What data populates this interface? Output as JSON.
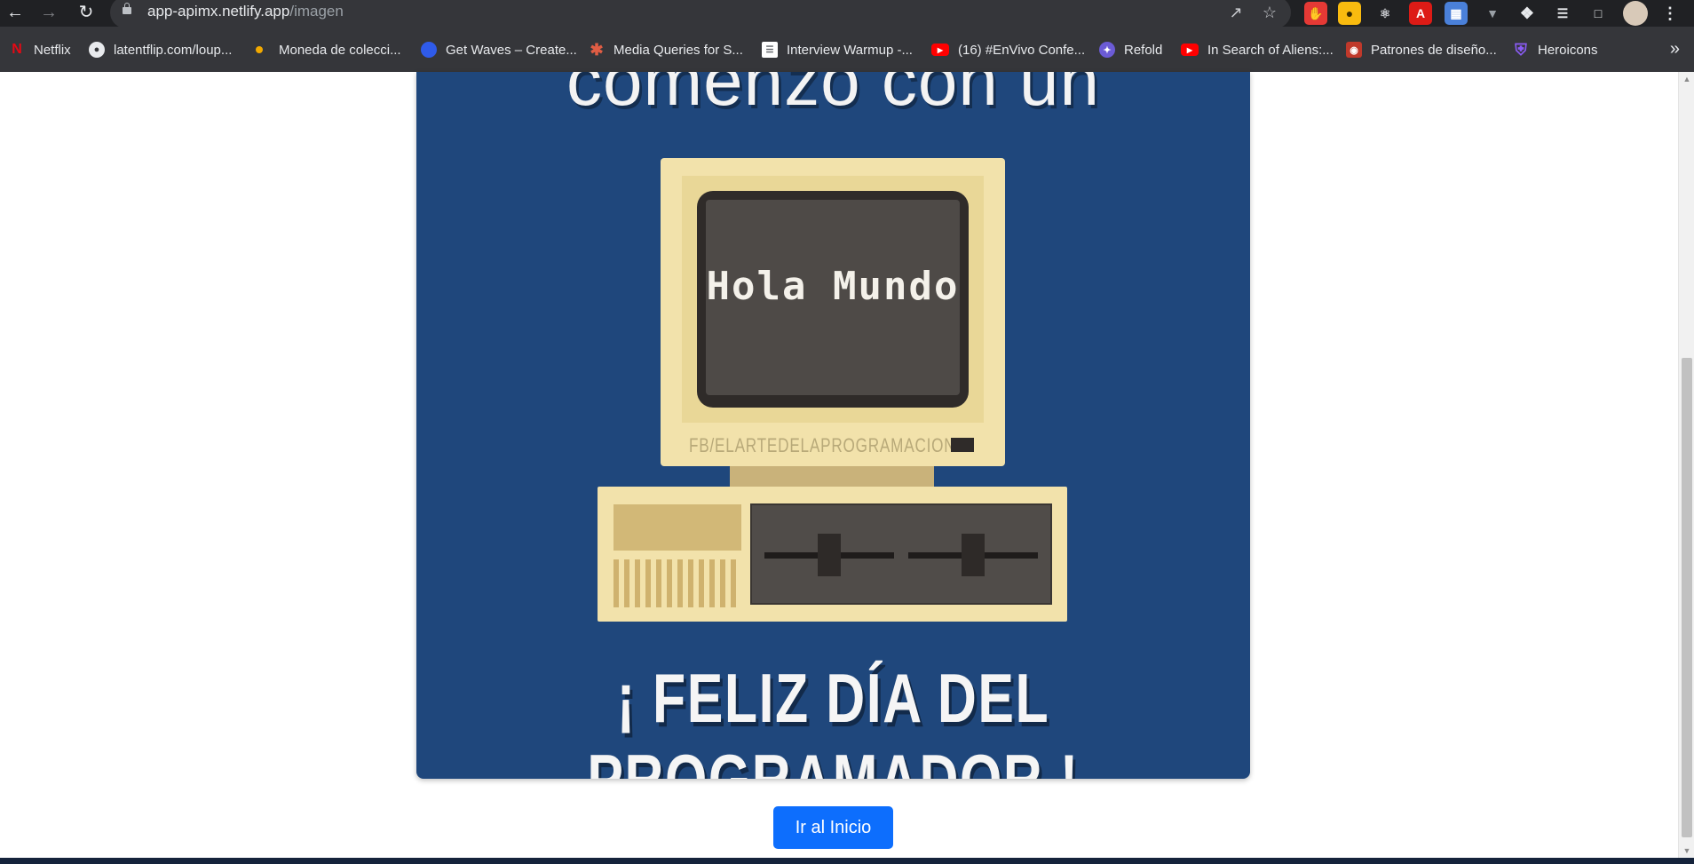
{
  "browser": {
    "url_host": "app-apimx.netlify.app",
    "url_path": "/imagen",
    "icons": [
      "back-arrow-icon",
      "forward-arrow-icon",
      "reload-icon",
      "lock-icon",
      "share-icon",
      "star-icon",
      "extensions-icon",
      "reading-list-icon",
      "side-panel-icon",
      "profile-avatar",
      "more-menu-icon"
    ]
  },
  "bookmarks": [
    {
      "label": "Netflix",
      "icon": "netflix-icon",
      "color": "#e50914"
    },
    {
      "label": "latentflip.com/loup...",
      "icon": "globe-icon",
      "color": "#e8eaed"
    },
    {
      "label": "Moneda de colecci...",
      "icon": "coin-icon",
      "color": "#f2a900"
    },
    {
      "label": "Get Waves – Create...",
      "icon": "waves-icon",
      "color": "#2f5bea"
    },
    {
      "label": "Media Queries for S...",
      "icon": "asterisk-icon",
      "color": "#e05d44"
    },
    {
      "label": "Interview Warmup -...",
      "icon": "document-icon",
      "color": "#ffffff"
    },
    {
      "label": "(16) #EnVivo Confe...",
      "icon": "youtube-icon",
      "color": "#ff0000"
    },
    {
      "label": "Refold",
      "icon": "refold-icon",
      "color": "#6b5bd6"
    },
    {
      "label": "In Search of Aliens:...",
      "icon": "youtube-icon",
      "color": "#ff0000"
    },
    {
      "label": "Patrones de diseño...",
      "icon": "raccoon-icon",
      "color": "#c0392b"
    },
    {
      "label": "Heroicons",
      "icon": "shield-icon",
      "color": "#8b5cf6"
    }
  ],
  "page": {
    "headline": "comenzó con un",
    "screen_text": "Hola Mundo",
    "brand": "FB/ELARTEDELAPROGRAMACION",
    "footer": "¡ FELIZ DÍA DEL PROGRAMADOR !",
    "button_label": "Ir al Inicio"
  },
  "colors": {
    "card_background": "#1f477c",
    "button": "#0d6efd",
    "browser_chrome": "#202124",
    "bookmarks_bar": "#35363a"
  }
}
